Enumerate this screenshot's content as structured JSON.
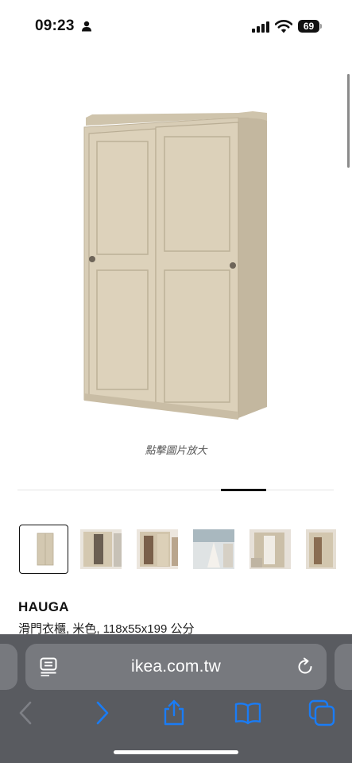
{
  "status_bar": {
    "time": "09:23",
    "battery_level": "69",
    "icons": [
      "person-icon",
      "signal-icon",
      "wifi-icon",
      "battery-icon"
    ]
  },
  "product": {
    "zoom_hint": "點擊圖片放大",
    "name": "HAUGA",
    "description": "滑門衣櫃, 米色, 118x55x199 公分"
  },
  "gallery": {
    "thumbnail_count": 6,
    "selected_index": 0
  },
  "browser": {
    "url": "ikea.com.tw",
    "icons": [
      "reader-mode-icon",
      "reload-icon",
      "back-chevron-icon",
      "forward-chevron-icon",
      "share-icon",
      "bookmarks-icon",
      "tabs-icon"
    ]
  },
  "colors": {
    "accent_blue": "#1a7cf5",
    "toolbar_bg": "#595b60",
    "address_bg": "#77797e",
    "wardrobe_beige": "#d6cbb4"
  }
}
